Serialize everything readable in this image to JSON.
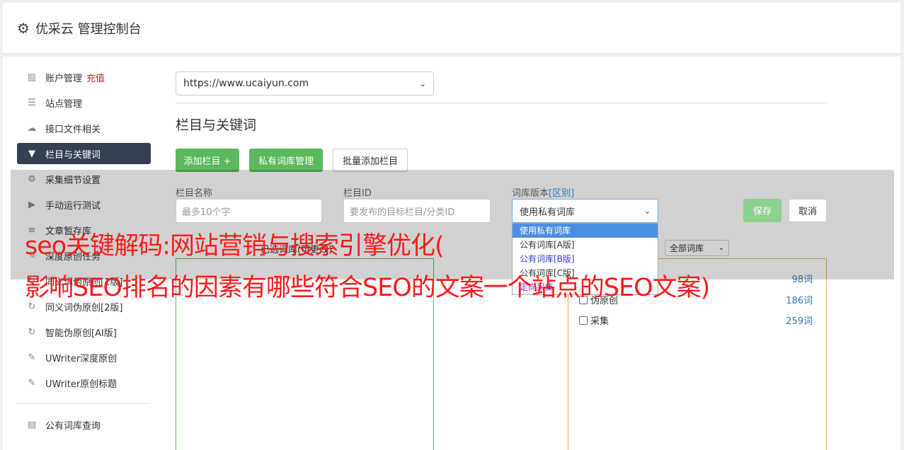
{
  "header": {
    "title": "优采云 管理控制台"
  },
  "sidebar": {
    "items": [
      {
        "label": "账户管理",
        "extra": "充值",
        "icon": "bar-chart-icon"
      },
      {
        "label": "站点管理",
        "icon": "server-icon"
      },
      {
        "label": "接口文件相关",
        "icon": "cloud-upload-icon"
      },
      {
        "label": "栏目与关键词",
        "icon": "filter-icon",
        "active": true
      },
      {
        "label": "采集细节设置",
        "icon": "cogs-icon"
      },
      {
        "label": "手动运行测试",
        "icon": "play-icon"
      },
      {
        "label": "文章暂存库",
        "icon": "database-icon"
      },
      {
        "label": "深度原创任务",
        "icon": "edit-icon"
      },
      {
        "label": "同义词伪原创[1版]",
        "icon": "refresh-icon"
      },
      {
        "label": "同义词伪原创[2版]",
        "icon": "refresh-icon"
      },
      {
        "label": "智能伪原创[AI版]",
        "icon": "refresh-icon"
      },
      {
        "label": "UWriter深度原创",
        "icon": "edit-icon"
      },
      {
        "label": "UWriter原创标题",
        "icon": "edit-icon"
      }
    ],
    "bottom_items": [
      {
        "label": "公有词库查询",
        "icon": "book-icon"
      }
    ]
  },
  "main": {
    "site_select": "https://www.ucaiyun.com",
    "section_title": "栏目与关键词",
    "buttons": {
      "add_column": "添加栏目 +",
      "private_lib": "私有词库管理",
      "batch_add": "批量添加栏目"
    },
    "form": {
      "name_label": "栏目名称",
      "name_placeholder": "最多10个字",
      "id_label": "栏目ID",
      "id_placeholder": "要发布的目标栏目/分类ID",
      "version_label": "词库版本",
      "version_link": "[区别]",
      "version_value": "使用私有词库",
      "save": "保存",
      "cancel": "取消"
    },
    "dropdown_options": [
      "使用私有词库",
      "公有词库[A版]",
      "公有词库[B版]",
      "公有词库[C版]",
      "定向采集"
    ],
    "mid_label": "已选词库(可更改)",
    "lib_filter": "全部词库",
    "libraries": [
      {
        "name": "热门",
        "count": "98词"
      },
      {
        "name": "伪原创",
        "count": "186词"
      },
      {
        "name": "采集",
        "count": "259词"
      }
    ]
  },
  "overlay_text": {
    "line1": "seo关键解码:网站营销与搜索引擎优化(",
    "line2": "影响SEO排名的因素有哪些符合SEO的文案一个站点的SEO文案)"
  },
  "colors": {
    "accent_green": "#5cb85c",
    "active_nav": "#343f52",
    "headline_red": "#ff1a1a",
    "link_blue": "#337ab7"
  }
}
